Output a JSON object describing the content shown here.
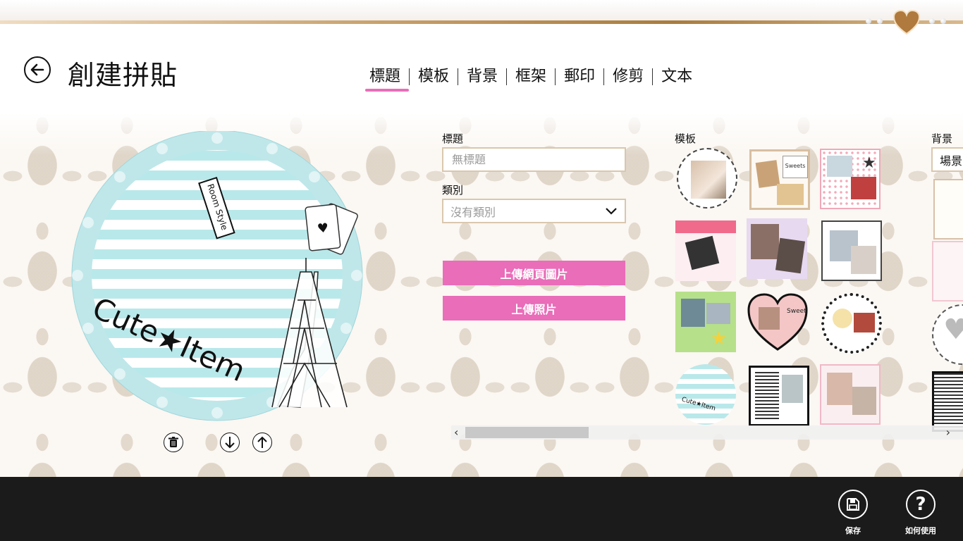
{
  "header": {
    "title": "創建拼貼",
    "back_icon": "arrow-left-icon"
  },
  "tabs": [
    {
      "label": "標題",
      "active": true
    },
    {
      "label": "模板",
      "active": false
    },
    {
      "label": "背景",
      "active": false
    },
    {
      "label": "框架",
      "active": false
    },
    {
      "label": "郵印",
      "active": false
    },
    {
      "label": "修剪",
      "active": false
    },
    {
      "label": "文本",
      "active": false
    }
  ],
  "canvas": {
    "text_main": "Cute★Item",
    "text_tag": "Room Style"
  },
  "form": {
    "title_label": "標題",
    "title_placeholder": "無標題",
    "category_label": "類別",
    "category_value": "沒有類別",
    "upload_web_label": "上傳網頁圖片",
    "upload_photo_label": "上傳照片"
  },
  "templates": {
    "label": "模板",
    "item_texts": [
      "Sweets",
      "Sweet & Cool",
      "Cute★Item"
    ]
  },
  "backgrounds": {
    "label": "背景",
    "dropdown_value": "場景"
  },
  "appbar": {
    "save_label": "保存",
    "help_label": "如何使用"
  },
  "colors": {
    "accent": "#e96db9",
    "field_border": "#d9c7ae",
    "appbar": "#1b1b1b",
    "stripe": "#b9e8ea"
  }
}
